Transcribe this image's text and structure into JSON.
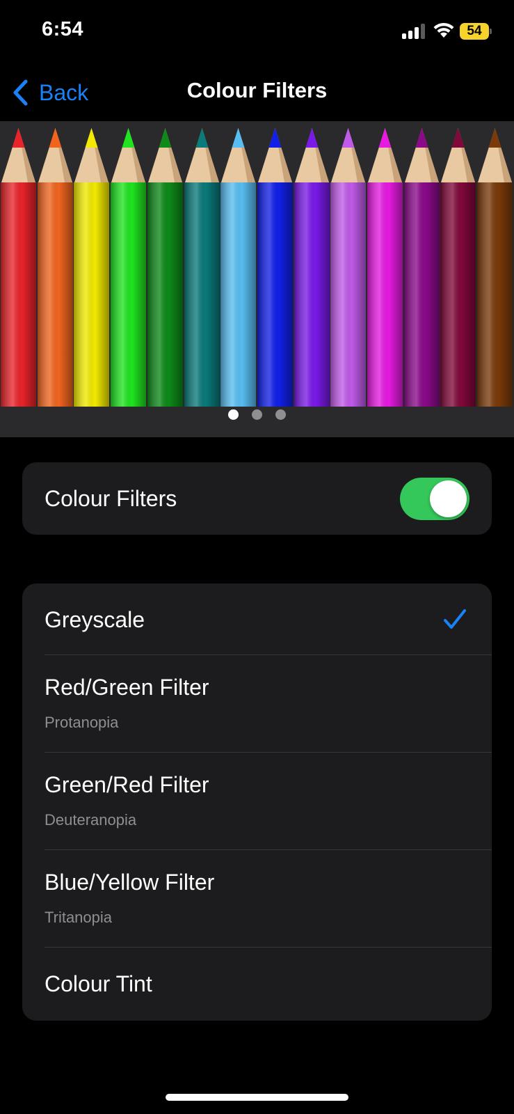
{
  "status_bar": {
    "time": "6:54",
    "battery_level": "54",
    "battery_color": "#f5d22c",
    "icons": [
      "cellular-signal-icon",
      "wifi-icon",
      "battery-icon"
    ]
  },
  "nav": {
    "back_label": "Back",
    "title": "Colour Filters",
    "accent_color": "#1a82f7"
  },
  "banner": {
    "pencil_colors": [
      "#e8242a",
      "#f0641e",
      "#f2ea00",
      "#1fe41f",
      "#0d8a18",
      "#0a7a7a",
      "#58bdf2",
      "#1020e8",
      "#7a1ae8",
      "#c05ae8",
      "#e61ae0",
      "#8a0a8a",
      "#80083a",
      "#7a3a0a"
    ],
    "page_count": 3,
    "active_page": 0
  },
  "colour_filters_toggle": {
    "label": "Colour Filters",
    "enabled": true,
    "on_color": "#34c759"
  },
  "filters": {
    "items": [
      {
        "label": "Greyscale",
        "subtitle": "",
        "selected": true
      },
      {
        "label": "Red/Green Filter",
        "subtitle": "Protanopia",
        "selected": false
      },
      {
        "label": "Green/Red Filter",
        "subtitle": "Deuteranopia",
        "selected": false
      },
      {
        "label": "Blue/Yellow Filter",
        "subtitle": "Tritanopia",
        "selected": false
      },
      {
        "label": "Colour Tint",
        "subtitle": "",
        "selected": false
      }
    ]
  }
}
